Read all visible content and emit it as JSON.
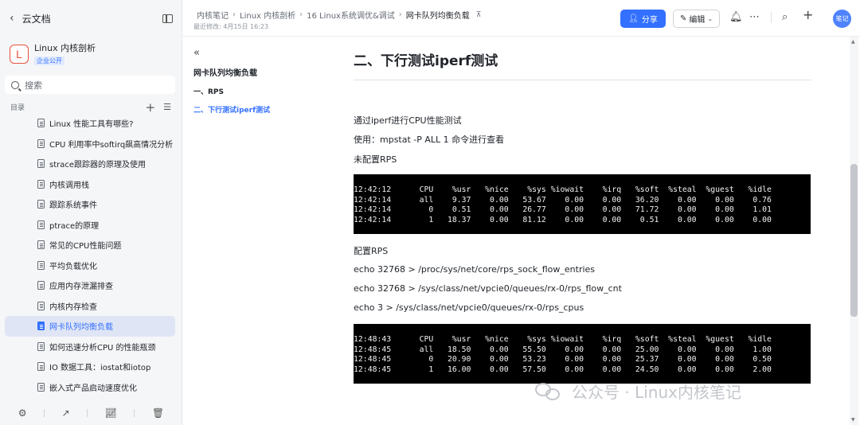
{
  "sidebar": {
    "back_label": "云文档",
    "kb_logo": "L",
    "kb_name": "Linux 内核剖析",
    "kb_badge": "企业公开",
    "search_placeholder": "搜索",
    "toc_label": "目录",
    "items": [
      {
        "label": "Linux 性能工具有哪些?",
        "active": false
      },
      {
        "label": "CPU 利用率中softirq飙高情况分析",
        "active": false
      },
      {
        "label": "strace跟踪器的原理及使用",
        "active": false
      },
      {
        "label": "内核调用栈",
        "active": false
      },
      {
        "label": "跟踪系统事件",
        "active": false
      },
      {
        "label": "ptrace的原理",
        "active": false
      },
      {
        "label": "常见的CPU性能问题",
        "active": false
      },
      {
        "label": "平均负载优化",
        "active": false
      },
      {
        "label": "应用内存泄漏排查",
        "active": false
      },
      {
        "label": "内核内存检查",
        "active": false
      },
      {
        "label": "网卡队列均衡负载",
        "active": true
      },
      {
        "label": "如何迅速分析CPU 的性能瓶颈",
        "active": false
      },
      {
        "label": "IO 数据工具：iostat和iotop",
        "active": false
      },
      {
        "label": "嵌入式产品启动速度优化",
        "active": false
      }
    ]
  },
  "header": {
    "breadcrumbs": [
      "内核笔记",
      "Linux 内核剖析",
      "16 Linux系统调优&调试",
      "网卡队列均衡负载"
    ],
    "last_modified": "最近修改: 4月15日 16:23",
    "share_label": "分享",
    "edit_label": "编辑",
    "avatar_text": "笔记"
  },
  "outline": {
    "title": "网卡队列均衡负载",
    "items": [
      {
        "label": "一、RPS",
        "active": false
      },
      {
        "label": "二、下行测试iperf测试",
        "active": true
      }
    ]
  },
  "document": {
    "heading": "二、下行测试iperf测试",
    "p1": "通过iperf进行CPU性能测试",
    "p2": "使用：mpstat -P ALL 1  命令进行查看",
    "p3": "未配置RPS",
    "term1": {
      "header": [
        "CPU",
        "%usr",
        "%nice",
        "%sys",
        "%iowait",
        "%irq",
        "%soft",
        "%steal",
        "%guest",
        "%idle"
      ],
      "header_time": "12:42:12",
      "rows": [
        [
          "12:42:14",
          "all",
          "9.37",
          "0.00",
          "53.67",
          "0.00",
          "0.00",
          "36.20",
          "0.00",
          "0.00",
          "0.76"
        ],
        [
          "12:42:14",
          "0",
          "0.51",
          "0.00",
          "26.77",
          "0.00",
          "0.00",
          "71.72",
          "0.00",
          "0.00",
          "1.01"
        ],
        [
          "12:42:14",
          "1",
          "18.37",
          "0.00",
          "81.12",
          "0.00",
          "0.00",
          "0.51",
          "0.00",
          "0.00",
          "0.00"
        ]
      ]
    },
    "p4": "配置RPS",
    "cmd1": "echo 32768 > /proc/sys/net/core/rps_sock_flow_entries",
    "cmd2": "echo 32768 > /sys/class/net/vpcie0/queues/rx-0/rps_flow_cnt",
    "cmd3": "echo 3 > /sys/class/net/vpcie0/queues/rx-0/rps_cpus",
    "term2": {
      "header": [
        "CPU",
        "%usr",
        "%nice",
        "%sys",
        "%iowait",
        "%irq",
        "%soft",
        "%steal",
        "%guest",
        "%idle"
      ],
      "header_time": "12:48:43",
      "rows": [
        [
          "12:48:45",
          "all",
          "18.50",
          "0.00",
          "55.50",
          "0.00",
          "0.00",
          "25.00",
          "0.00",
          "0.00",
          "1.00"
        ],
        [
          "12:48:45",
          "0",
          "20.90",
          "0.00",
          "53.23",
          "0.00",
          "0.00",
          "25.37",
          "0.00",
          "0.00",
          "0.50"
        ],
        [
          "12:48:45",
          "1",
          "16.00",
          "0.00",
          "57.50",
          "0.00",
          "0.00",
          "24.50",
          "0.00",
          "0.00",
          "2.00"
        ]
      ]
    }
  },
  "watermark": "公众号 · Linux内核笔记"
}
